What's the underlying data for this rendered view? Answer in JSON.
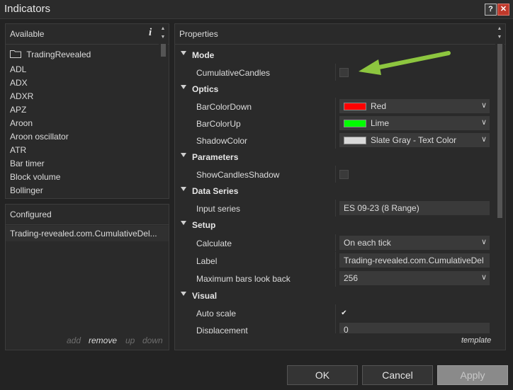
{
  "window": {
    "title": "Indicators",
    "help_label": "?",
    "close_label": "✕"
  },
  "available": {
    "header": "Available",
    "info_icon": "i",
    "folder": "TradingRevealed",
    "items": [
      "ADL",
      "ADX",
      "ADXR",
      "APZ",
      "Aroon",
      "Aroon oscillator",
      "ATR",
      "Bar timer",
      "Block volume",
      "Bollinger"
    ]
  },
  "configured": {
    "header": "Configured",
    "items": [
      "Trading-revealed.com.CumulativeDel..."
    ],
    "actions": {
      "add": "add",
      "remove": "remove",
      "up": "up",
      "down": "down"
    }
  },
  "properties": {
    "header": "Properties",
    "template_label": "template",
    "categories": {
      "mode": "Mode",
      "optics": "Optics",
      "parameters": "Parameters",
      "data_series": "Data Series",
      "setup": "Setup",
      "visual": "Visual"
    },
    "fields": {
      "cumulative_candles": {
        "name": "CumulativeCandles",
        "checked": false
      },
      "bar_color_down": {
        "name": "BarColorDown",
        "value": "Red",
        "color": "#ff0000"
      },
      "bar_color_up": {
        "name": "BarColorUp",
        "value": "Lime",
        "color": "#00ff00"
      },
      "shadow_color": {
        "name": "ShadowColor",
        "value": "Slate Gray - Text Color",
        "color": "#d9d9d9"
      },
      "show_candles_shadow": {
        "name": "ShowCandlesShadow",
        "checked": false
      },
      "input_series": {
        "name": "Input series",
        "value": "ES 09-23 (8 Range)"
      },
      "calculate": {
        "name": "Calculate",
        "value": "On each tick"
      },
      "label": {
        "name": "Label",
        "value": "Trading-revealed.com.CumulativeDel"
      },
      "max_bars": {
        "name": "Maximum bars look back",
        "value": "256"
      },
      "auto_scale": {
        "name": "Auto scale",
        "checked": true
      },
      "displacement": {
        "name": "Displacement",
        "value": "0"
      }
    }
  },
  "buttons": {
    "ok": "OK",
    "cancel": "Cancel",
    "apply": "Apply"
  },
  "colors": {
    "annotation_arrow": "#8dc63f",
    "background": "#232323",
    "panel": "#2a2a2a"
  }
}
